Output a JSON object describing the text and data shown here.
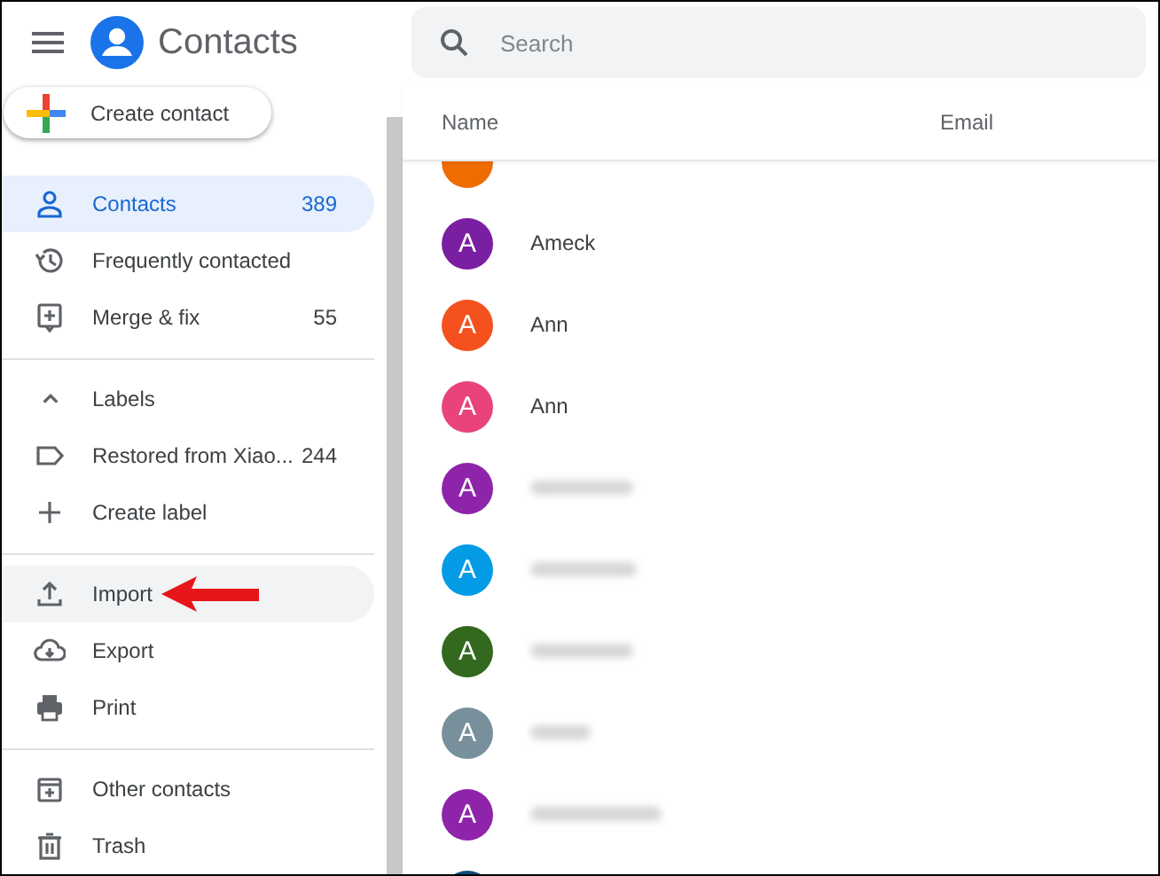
{
  "app": {
    "title": "Contacts"
  },
  "search": {
    "placeholder": "Search"
  },
  "create_button": {
    "label": "Create contact"
  },
  "sidebar": {
    "sections": [
      {
        "items": [
          {
            "kind": "contacts",
            "label": "Contacts",
            "count": "389",
            "selected": true,
            "hovered": false,
            "callout_arrow": false
          },
          {
            "kind": "history",
            "label": "Frequently contacted",
            "selected": false,
            "hovered": false,
            "callout_arrow": false
          },
          {
            "kind": "merge",
            "label": "Merge & fix",
            "count": "55",
            "selected": false,
            "hovered": false,
            "callout_arrow": false
          }
        ]
      },
      {
        "items": [
          {
            "kind": "toggle",
            "label": "Labels",
            "expanded": true,
            "selected": false,
            "hovered": false,
            "callout_arrow": false
          },
          {
            "kind": "label",
            "label": "Restored from Xiao...",
            "count": "244",
            "selected": false,
            "hovered": false,
            "callout_arrow": false
          },
          {
            "kind": "add",
            "label": "Create label",
            "selected": false,
            "hovered": false,
            "callout_arrow": false
          }
        ]
      },
      {
        "items": [
          {
            "kind": "import",
            "label": "Import",
            "selected": false,
            "hovered": true,
            "callout_arrow": true
          },
          {
            "kind": "export",
            "label": "Export",
            "selected": false,
            "hovered": false,
            "callout_arrow": false
          },
          {
            "kind": "print",
            "label": "Print",
            "selected": false,
            "hovered": false,
            "callout_arrow": false
          }
        ]
      },
      {
        "items": [
          {
            "kind": "other",
            "label": "Other contacts",
            "selected": false,
            "hovered": false,
            "callout_arrow": false
          },
          {
            "kind": "trash",
            "label": "Trash",
            "selected": false,
            "hovered": false,
            "callout_arrow": false
          }
        ]
      }
    ]
  },
  "table": {
    "columns": [
      "Name",
      "Email"
    ],
    "rows": [
      {
        "color": "#ef6c00"
      },
      {
        "initial": "A",
        "name": "Ameck",
        "color": "#7b1fa2"
      },
      {
        "initial": "A",
        "name": "Ann",
        "color": "#f4511e"
      },
      {
        "initial": "A",
        "name": "Ann",
        "color": "#e8437d"
      },
      {
        "initial": "A",
        "color": "#8e24aa",
        "blurred": true
      },
      {
        "initial": "A",
        "color": "#039be5",
        "blurred": true
      },
      {
        "initial": "A",
        "color": "#33691e",
        "blurred": true
      },
      {
        "initial": "A",
        "color": "#78909c",
        "blurred": true
      },
      {
        "initial": "A",
        "color": "#8e24aa",
        "blurred": true
      },
      {
        "color": "#0b4f7c"
      }
    ]
  }
}
